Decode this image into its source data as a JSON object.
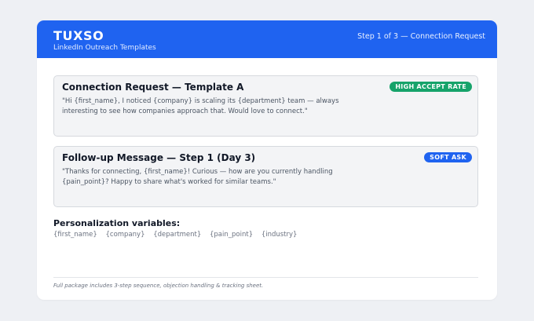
{
  "header": {
    "brand": "TUXSO",
    "subtitle": "LinkedIn Outreach Templates",
    "step": "Step 1 of 3 — Connection Request",
    "background": "#1f63f0"
  },
  "templates": [
    {
      "title": "Connection Request — Template A",
      "badge": "HIGH ACCEPT RATE",
      "badge_color": "#16a36a",
      "body": "\"Hi {first_name}, I noticed {company} is scaling its {department} team — always interesting to see how companies approach that. Would love to connect.\""
    },
    {
      "title": "Follow-up Message — Step 1 (Day 3)",
      "badge": "SOFT ASK",
      "badge_color": "#1f63f0",
      "body": "\"Thanks for connecting, {first_name}! Curious — how are you currently handling {pain_point}? Happy to share what's worked for similar teams.\""
    }
  ],
  "variables": {
    "title": "Personalization variables:",
    "items": [
      "{first_name}",
      "{company}",
      "{department}",
      "{pain_point}",
      "{industry}"
    ]
  },
  "footer": {
    "note": "Full package includes 3-step sequence, objection handling & tracking sheet."
  }
}
